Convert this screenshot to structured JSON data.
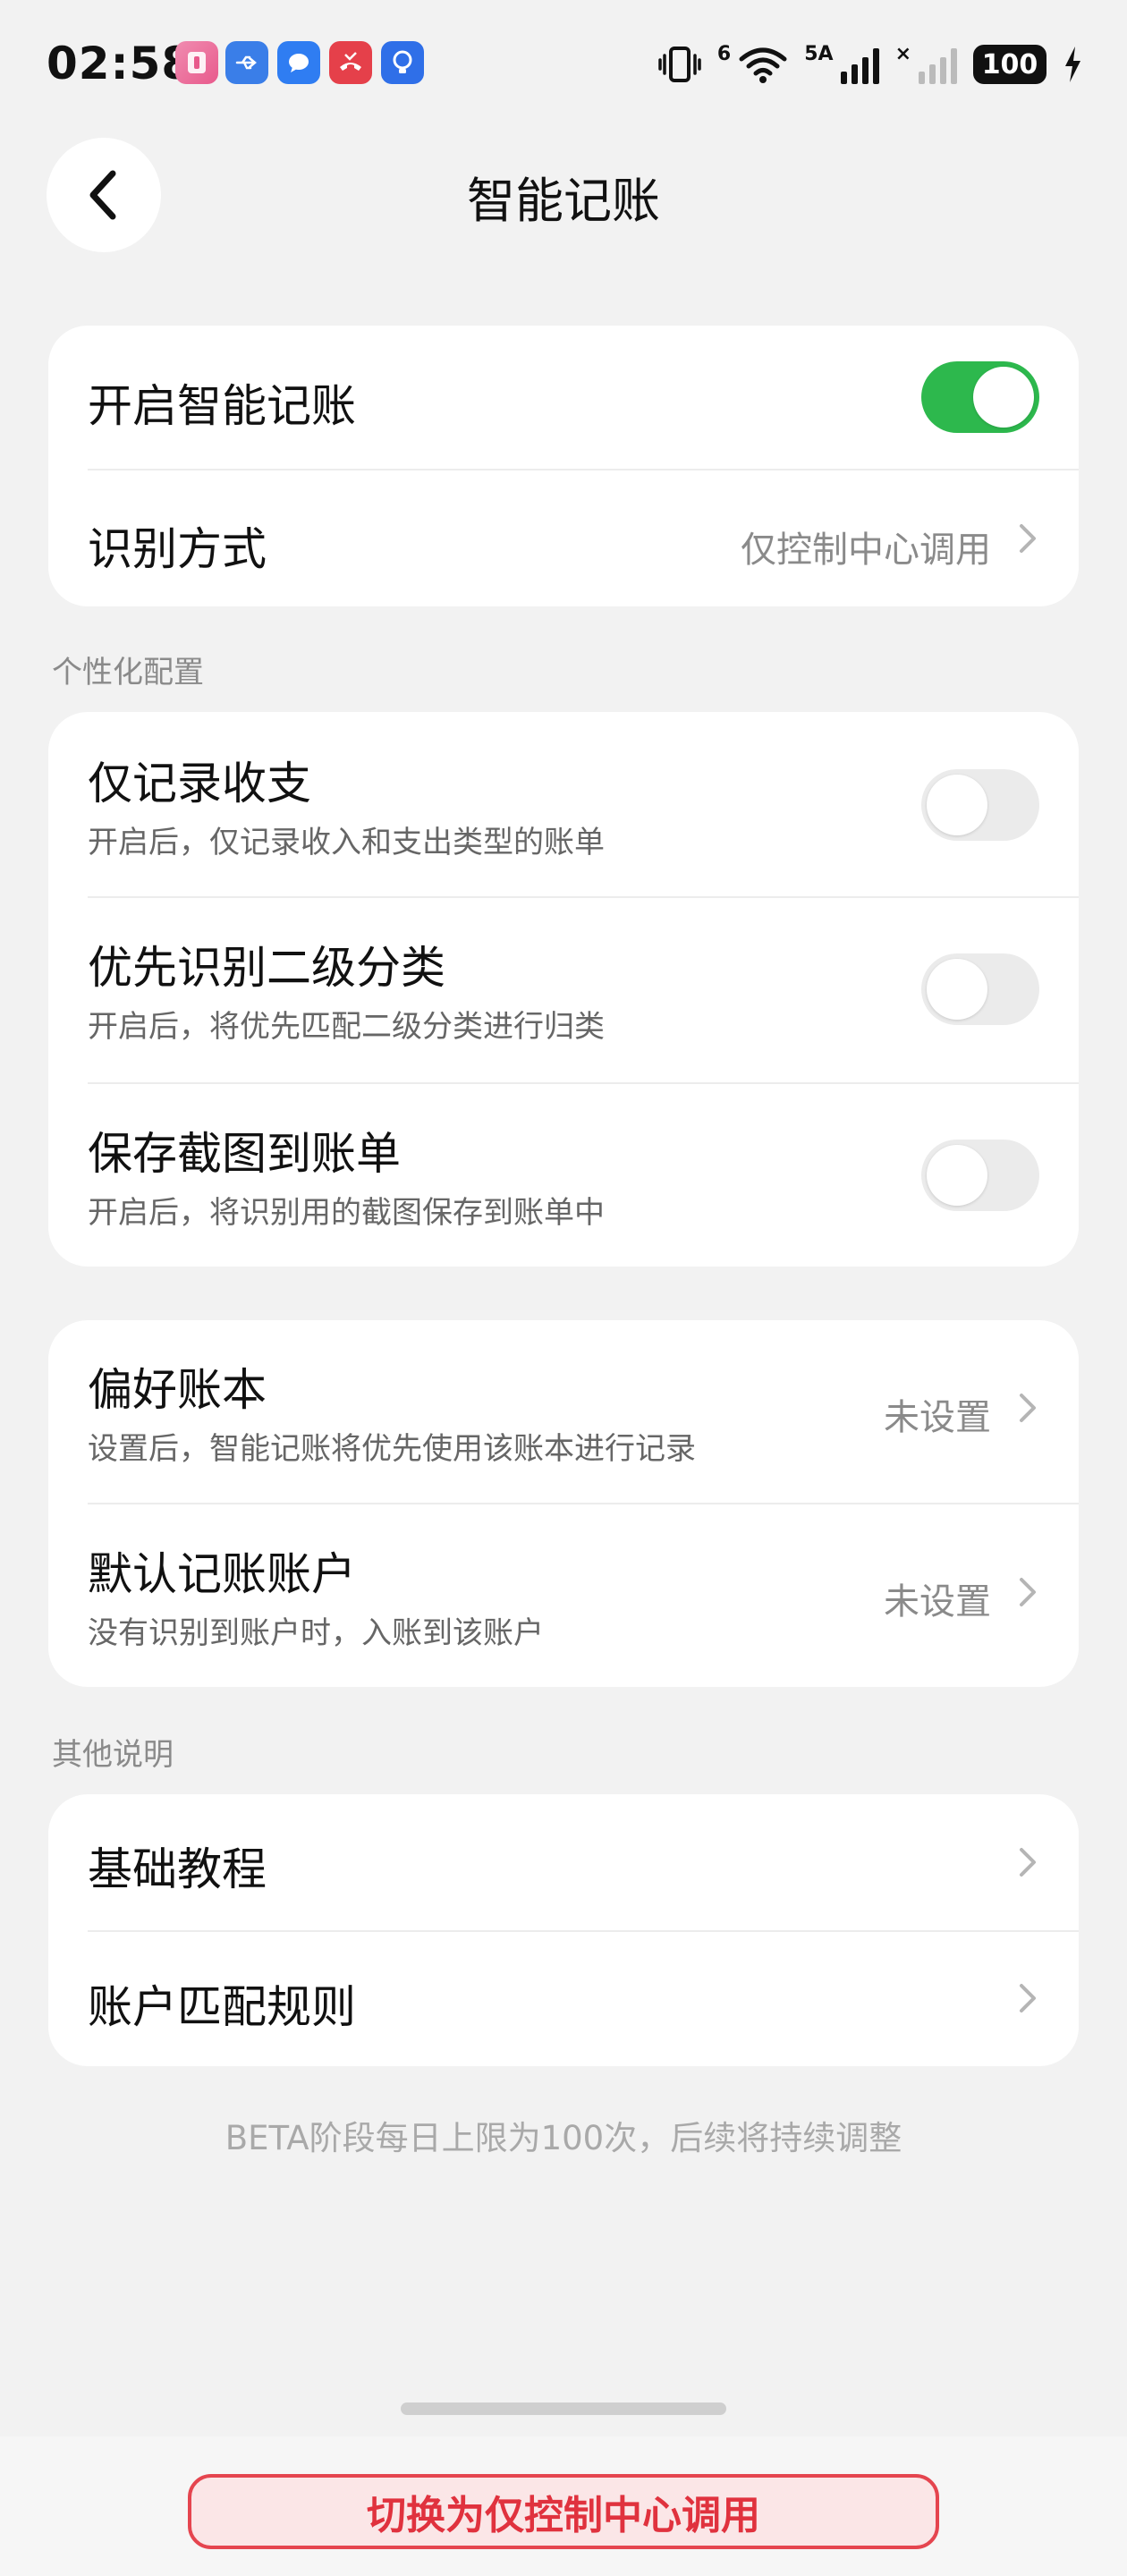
{
  "status_bar": {
    "time": "02:58",
    "notifications": [
      {
        "icon": "app-notification-icon",
        "color": "#e85a8c"
      },
      {
        "icon": "usb-icon",
        "color": "#3a7ee8"
      },
      {
        "icon": "message-icon",
        "color": "#2f7df2"
      },
      {
        "icon": "missed-call-icon",
        "color": "#e5404a"
      },
      {
        "icon": "lightbulb-icon",
        "color": "#2f6fe8"
      }
    ],
    "network_6": "6",
    "network_5a": "5A",
    "sim2_mark": "×",
    "battery": "100"
  },
  "header": {
    "back_icon": "chevron-left-icon",
    "title": "智能记账"
  },
  "main_card": {
    "enable_label": "开启智能记账",
    "enable_on": true,
    "recognize_label": "识别方式",
    "recognize_value": "仅控制中心调用"
  },
  "personalization": {
    "section_label": "个性化配置",
    "items": [
      {
        "label": "仅记录收支",
        "sub": "开启后，仅记录收入和支出类型的账单",
        "on": false
      },
      {
        "label": "优先识别二级分类",
        "sub": "开启后，将优先匹配二级分类进行归类",
        "on": false
      },
      {
        "label": "保存截图到账单",
        "sub": "开启后，将识别用的截图保存到账单中",
        "on": false
      }
    ]
  },
  "account_card": {
    "items": [
      {
        "label": "偏好账本",
        "sub": "设置后，智能记账将优先使用该账本进行记录",
        "value": "未设置"
      },
      {
        "label": "默认记账账户",
        "sub": "没有识别到账户时，入账到该账户",
        "value": "未设置"
      }
    ]
  },
  "other": {
    "section_label": "其他说明",
    "items": [
      {
        "label": "基础教程"
      },
      {
        "label": "账户匹配规则"
      }
    ]
  },
  "footnote": "BETA阶段每日上限为100次，后续将持续调整",
  "bottom_button": "切换为仅控制中心调用",
  "colors": {
    "accent_green": "#2db84d",
    "alert_red": "#e0323e",
    "background": "#f2f2f2"
  }
}
